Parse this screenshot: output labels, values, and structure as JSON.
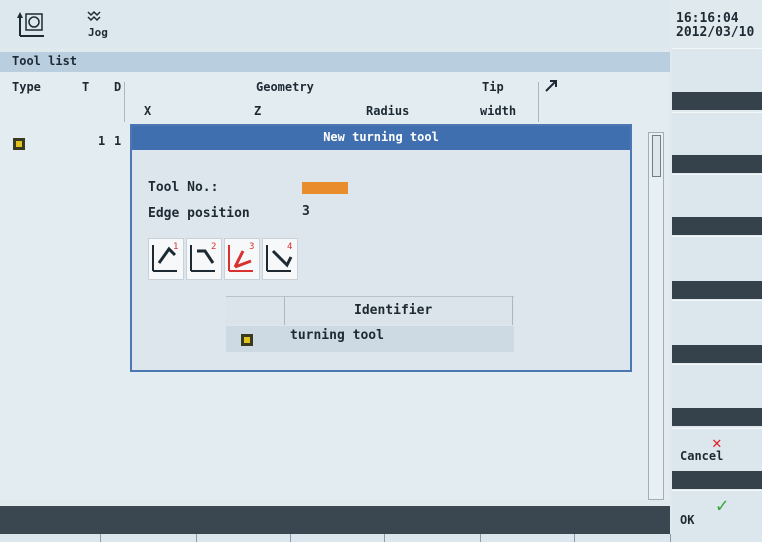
{
  "header": {
    "mode": "Jog",
    "clock_time": "16:16:04",
    "clock_date": "2012/03/10"
  },
  "tool_list": {
    "title": "Tool list",
    "columns": {
      "type": "Type",
      "t": "T",
      "d": "D",
      "geometry": "Geometry",
      "x": "X",
      "z": "Z",
      "radius": "Radius",
      "tip": "Tip",
      "width": "width"
    },
    "row": {
      "t": "1",
      "d": "1"
    }
  },
  "dialog": {
    "title": "New turning tool",
    "tool_no_label": "Tool No.:",
    "edge_position_label": "Edge position",
    "edge_position_value": "3",
    "edge_positions": [
      "1",
      "2",
      "3",
      "4"
    ],
    "selected_edge": "3",
    "identifier_header": "Identifier",
    "identifier_value": "turning tool"
  },
  "softkeys": {
    "cancel": "Cancel",
    "ok": "OK"
  },
  "colors": {
    "dialog_title": "#3f6fae",
    "input_highlight": "#e88c2c",
    "cancel_x": "#e02020",
    "ok_check": "#3aa43a"
  }
}
